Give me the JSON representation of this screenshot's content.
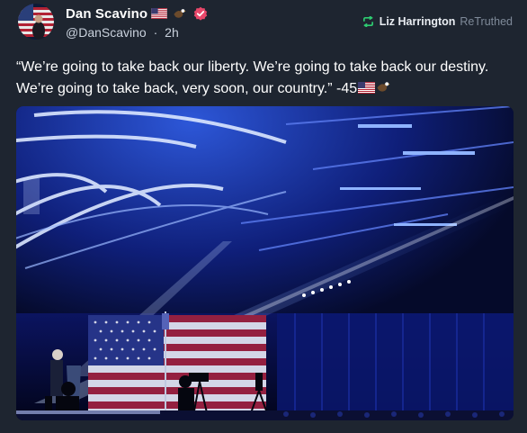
{
  "post": {
    "author": {
      "display_name": "Dan Scavino",
      "handle": "@DanScavino",
      "separator": "·",
      "time": "2h",
      "name_emojis": [
        "us-flag-emoji",
        "eagle-emoji"
      ],
      "verified": true
    },
    "retruth": {
      "by": "Liz Harrington",
      "label": "ReTruthed",
      "icon": "retruth-arrows-icon",
      "icon_color": "#2ecc71"
    },
    "text": "“We’re going to take back our liberty. We’re going to take back our destiny. We’re going to take back, very soon, our country.” -45",
    "text_trailing_emojis": [
      "us-flag-emoji",
      "eagle-emoji"
    ],
    "media": {
      "type": "image",
      "scene": "rally-stage-american-flag"
    }
  },
  "theme": {
    "background": "#1e2530",
    "verified_badge": "#e8476a",
    "muted_text": "#7f8a99"
  }
}
